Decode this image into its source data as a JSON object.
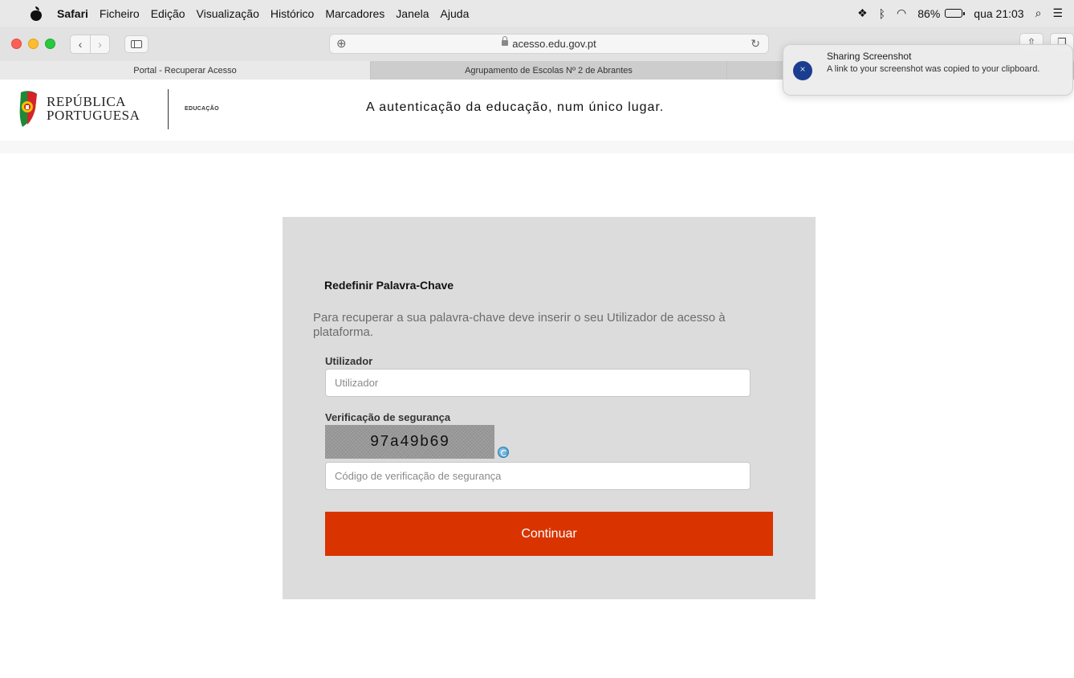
{
  "menubar": {
    "app": "Safari",
    "items": [
      "Ficheiro",
      "Edição",
      "Visualização",
      "Histórico",
      "Marcadores",
      "Janela",
      "Ajuda"
    ],
    "battery": "86%",
    "clock": "qua 21:03"
  },
  "toolbar": {
    "url": "acesso.edu.gov.pt"
  },
  "tabs": [
    {
      "label": "Portal - Recuperar Acesso"
    },
    {
      "label": "Agrupamento de Escolas Nº 2 de Abrantes"
    }
  ],
  "header": {
    "logo_line1": "REPÚBLICA",
    "logo_line2": "PORTUGUESA",
    "logo_sub": "EDUCAÇÃO",
    "tagline": "A autenticação da educação, num único lugar."
  },
  "form": {
    "title": "Redefinir Palavra-Chave",
    "description": "Para recuperar a sua palavra-chave deve inserir o seu Utilizador de acesso à plataforma.",
    "user_label": "Utilizador",
    "user_placeholder": "Utilizador",
    "security_label": "Verificação de segurança",
    "captcha_text": "97a49b69",
    "code_placeholder": "Código de verificação de segurança",
    "submit_label": "Continuar",
    "submit_color": "#d93400"
  },
  "notification": {
    "title": "Sharing Screenshot",
    "body": "A link to your screenshot was copied to your clipboard."
  }
}
